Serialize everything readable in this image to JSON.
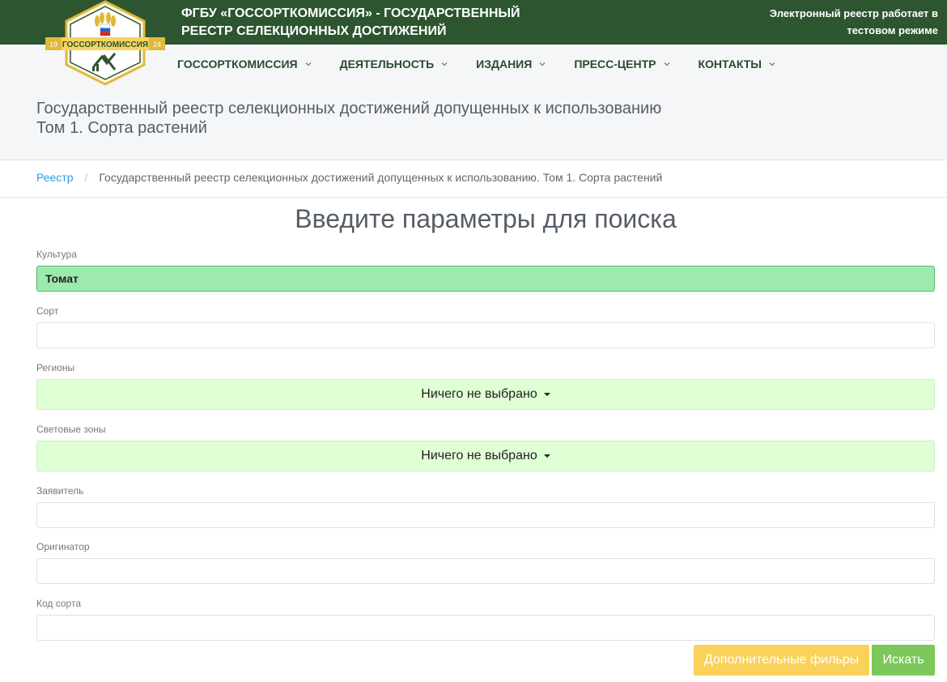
{
  "header": {
    "org_line1": "ФГБУ «ГОССОРТКОМИССИЯ» - ГОСУДАРСТВЕННЫЙ",
    "org_line2": "РЕЕСТР СЕЛЕКЦИОННЫХ ДОСТИЖЕНИЙ",
    "test_line1": "Электронный реестр работает в",
    "test_line2": "тестовом режиме",
    "logo_text": "ГОССОРТКОМИССИЯ",
    "logo_year_left": "19",
    "logo_year_right": "24"
  },
  "nav": {
    "items": [
      {
        "label": "ГОССОРТКОМИССИЯ"
      },
      {
        "label": "ДЕЯТЕЛЬНОСТЬ"
      },
      {
        "label": "ИЗДАНИЯ"
      },
      {
        "label": "ПРЕСС-ЦЕНТР"
      },
      {
        "label": "КОНТАКТЫ"
      }
    ]
  },
  "page": {
    "title_line1": "Государственный реестр селекционных достижений допущенных к использованию",
    "title_line2": "Том 1. Сорта растений"
  },
  "breadcrumb": {
    "root": "Реестр",
    "separator": "/",
    "current": "Государственный реестр селекционных достижений допущенных к использованию. Том 1. Сорта растений"
  },
  "search": {
    "title": "Введите параметры для поиска",
    "culture_label": "Культура",
    "culture_value": "Томат",
    "sort_label": "Сорт",
    "sort_value": "",
    "regions_label": "Регионы",
    "regions_value": "Ничего не выбрано",
    "zones_label": "Световые зоны",
    "zones_value": "Ничего не выбрано",
    "applicant_label": "Заявитель",
    "applicant_value": "",
    "originator_label": "Оригинатор",
    "originator_value": "",
    "code_label": "Код сорта",
    "code_value": "",
    "extra_button": "Дополнительные фильры",
    "search_button": "Искать"
  },
  "colors": {
    "topbar": "#2c5530",
    "filled_input": "#9deaae",
    "select_bg": "#dfffd4",
    "btn_extra": "#f8d25b",
    "btn_search": "#7cc85a",
    "link": "#2a9fd6"
  }
}
